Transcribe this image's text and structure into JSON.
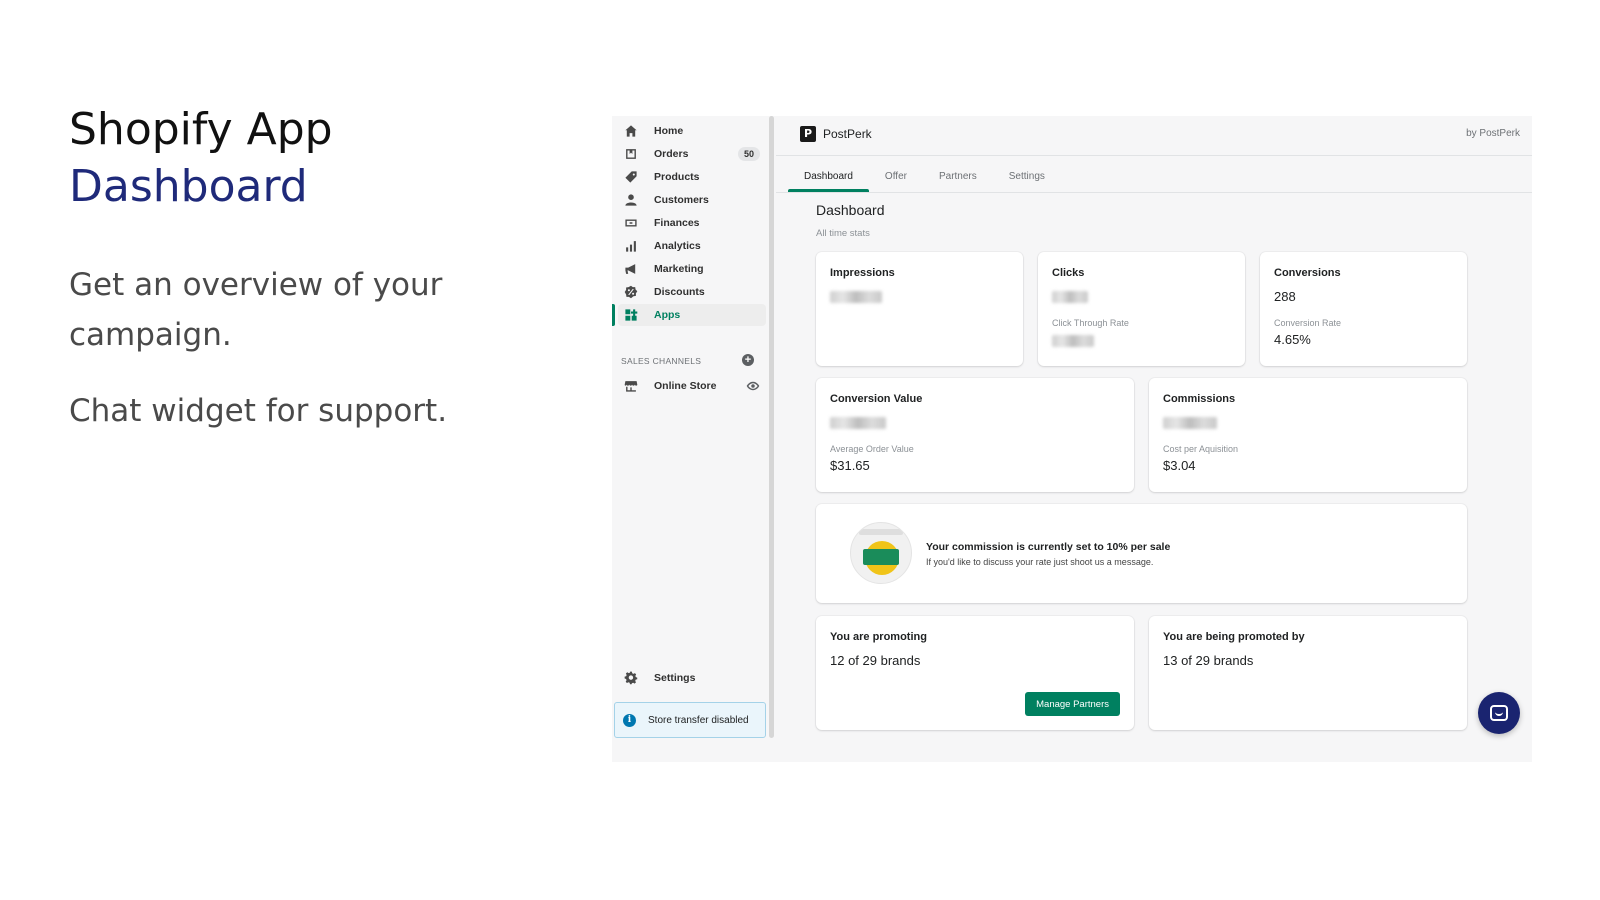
{
  "hero": {
    "title": "Shopify App",
    "subtitle": "Dashboard",
    "paragraph1": "Get an overview of your campaign.",
    "paragraph2": "Chat widget for support."
  },
  "sidebar": {
    "items": [
      {
        "label": "Home",
        "icon": "home-icon"
      },
      {
        "label": "Orders",
        "icon": "orders-icon",
        "badge": "50"
      },
      {
        "label": "Products",
        "icon": "tag-icon"
      },
      {
        "label": "Customers",
        "icon": "person-icon"
      },
      {
        "label": "Finances",
        "icon": "finances-icon"
      },
      {
        "label": "Analytics",
        "icon": "bar-chart-icon"
      },
      {
        "label": "Marketing",
        "icon": "megaphone-icon"
      },
      {
        "label": "Discounts",
        "icon": "discount-icon"
      },
      {
        "label": "Apps",
        "icon": "apps-icon",
        "active": true
      }
    ],
    "sales_channels_label": "SALES CHANNELS",
    "online_store": "Online Store",
    "settings": "Settings",
    "notice": "Store transfer disabled"
  },
  "app": {
    "name": "PostPerk",
    "by": "by PostPerk",
    "logo_letter": "P"
  },
  "tabs": [
    "Dashboard",
    "Offer",
    "Partners",
    "Settings"
  ],
  "dashboard": {
    "title": "Dashboard",
    "subtitle": "All time stats",
    "impressions": {
      "title": "Impressions"
    },
    "clicks": {
      "title": "Clicks",
      "sub_label": "Click Through Rate"
    },
    "conversions": {
      "title": "Conversions",
      "value": "288",
      "sub_label": "Conversion Rate",
      "sub_value": "4.65%"
    },
    "conversion_value": {
      "title": "Conversion Value",
      "sub_label": "Average Order Value",
      "sub_value": "$31.65"
    },
    "commissions": {
      "title": "Commissions",
      "sub_label": "Cost per Aquisition",
      "sub_value": "$3.04"
    },
    "promo": {
      "title": "Your commission is currently set to 10% per sale",
      "text": "If you'd like to discuss your rate just shoot us a message."
    },
    "promoting": {
      "title": "You are promoting",
      "value": "12 of 29 brands",
      "button": "Manage Partners"
    },
    "promoted_by": {
      "title": "You are being promoted by",
      "value": "13 of 29 brands"
    }
  },
  "colors": {
    "accent": "#008060",
    "hero_subtitle": "#1f2a7a",
    "chat_bubble": "#1a2470"
  }
}
